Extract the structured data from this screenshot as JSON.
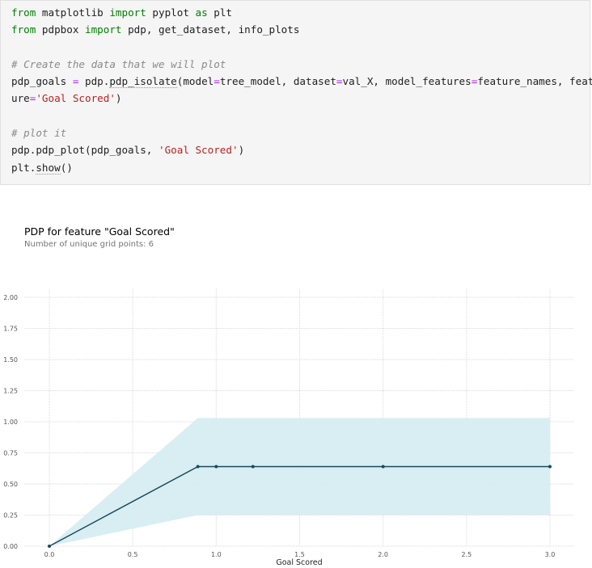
{
  "code": {
    "line1": {
      "kw1": "from",
      "mod": " matplotlib ",
      "kw2": "import",
      "rest": " pyplot ",
      "kw3": "as",
      "alias": " plt"
    },
    "line2": {
      "kw1": "from",
      "mod": " pdpbox ",
      "kw2": "import",
      "rest": " pdp, get_dataset, info_plots"
    },
    "line3": "# Create the data that we will plot",
    "line4": {
      "var": "pdp_goals ",
      "eq": "=",
      "call_a": " pdp.",
      "call_b": "pdp_isolate",
      "args_a": "(model",
      "eq2": "=",
      "args_b": "tree_model, dataset",
      "eq3": "=",
      "args_c": "val_X, model_features",
      "eq4": "=",
      "args_d": "feature_names, feat"
    },
    "line5": {
      "pre": "ure",
      "eq": "=",
      "str": "'Goal Scored'",
      "post": ")"
    },
    "line6": "# plot it",
    "line7": {
      "pre": "pdp.pdp_plot(pdp_goals, ",
      "str": "'Goal Scored'",
      "post": ")"
    },
    "line8": {
      "pre": "plt.",
      "fn": "show",
      "post": "()"
    }
  },
  "plot": {
    "title": "PDP for feature \"Goal Scored\"",
    "subtitle": "Number of unique grid points: 6"
  },
  "chart_data": {
    "type": "line",
    "xlabel": "Goal Scored",
    "ylabel": "",
    "xlim": [
      0.0,
      3.0
    ],
    "ylim": [
      0.0,
      2.0
    ],
    "x_ticks": [
      "0.0",
      "0.5",
      "1.0",
      "1.5",
      "2.0",
      "2.5",
      "3.0"
    ],
    "y_ticks": [
      "0.00",
      "0.25",
      "0.50",
      "0.75",
      "1.00",
      "1.25",
      "1.50",
      "1.75",
      "2.00"
    ],
    "series": [
      {
        "x": [
          0.0,
          0.89,
          1.0,
          1.22,
          2.0,
          3.0
        ],
        "y": [
          0.0,
          0.64,
          0.64,
          0.64,
          0.64,
          0.64
        ]
      }
    ],
    "band": {
      "x": [
        0.0,
        0.89,
        1.0,
        1.22,
        2.0,
        3.0
      ],
      "lower": [
        0.0,
        0.25,
        0.25,
        0.25,
        0.25,
        0.25
      ],
      "upper": [
        0.0,
        1.03,
        1.03,
        1.03,
        1.03,
        1.03
      ]
    },
    "grid": true,
    "colors": {
      "line": "#1a4a5a",
      "band": "#d6edf2",
      "grid": "#dadada",
      "tick": "#555555"
    }
  }
}
